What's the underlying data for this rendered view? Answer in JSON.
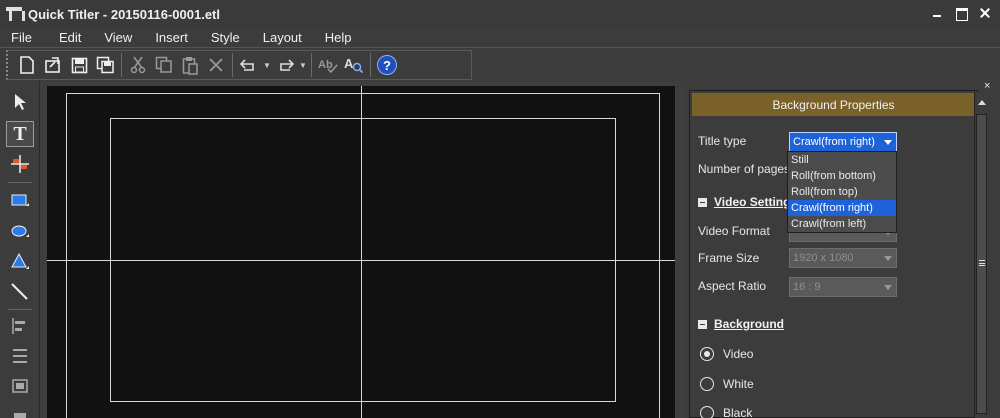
{
  "window": {
    "title": "Quick Titler - 20150116-0001.etl"
  },
  "menu": [
    "File",
    "Edit",
    "View",
    "Insert",
    "Style",
    "Layout",
    "Help"
  ],
  "toolbar": {
    "buttons": [
      "new-icon",
      "open-icon",
      "save-icon",
      "save-as-icon",
      "cut-icon",
      "copy-icon",
      "paste-icon",
      "delete-icon",
      "undo-icon",
      "redo-icon",
      "spell-check-icon",
      "find-icon",
      "help-icon"
    ],
    "help_glyph": "?"
  },
  "palette": {
    "tools": [
      "select-arrow-icon",
      "text-tool-icon",
      "center-guide-icon",
      "rectangle-icon",
      "ellipse-icon",
      "triangle-icon",
      "line-icon",
      "align-icon",
      "distribute-icon",
      "frame-icon"
    ],
    "text_glyph": "T"
  },
  "panel": {
    "header": "Background Properties",
    "close_glyph": "×",
    "title_type_label": "Title type",
    "title_type_value": "Crawl(from right)",
    "pages_label": "Number of pages",
    "video_section": "Video Setting",
    "video_format_label": "Video Format",
    "frame_size_label": "Frame Size",
    "frame_size_value": "1920 x 1080",
    "aspect_label": "Aspect Ratio",
    "aspect_value": "16 : 9",
    "background_section": "Background",
    "bg_options": [
      {
        "label": "Video",
        "checked": true
      },
      {
        "label": "White",
        "checked": false
      },
      {
        "label": "Black",
        "checked": false
      }
    ]
  },
  "dropdown": {
    "options": [
      "Still",
      "Roll(from bottom)",
      "Roll(from top)",
      "Crawl(from right)",
      "Crawl(from left)"
    ],
    "selected": "Crawl(from right)"
  },
  "colors": {
    "panel_header": "#7a6129",
    "selection": "#1e62d8",
    "canvas": "#111111"
  }
}
